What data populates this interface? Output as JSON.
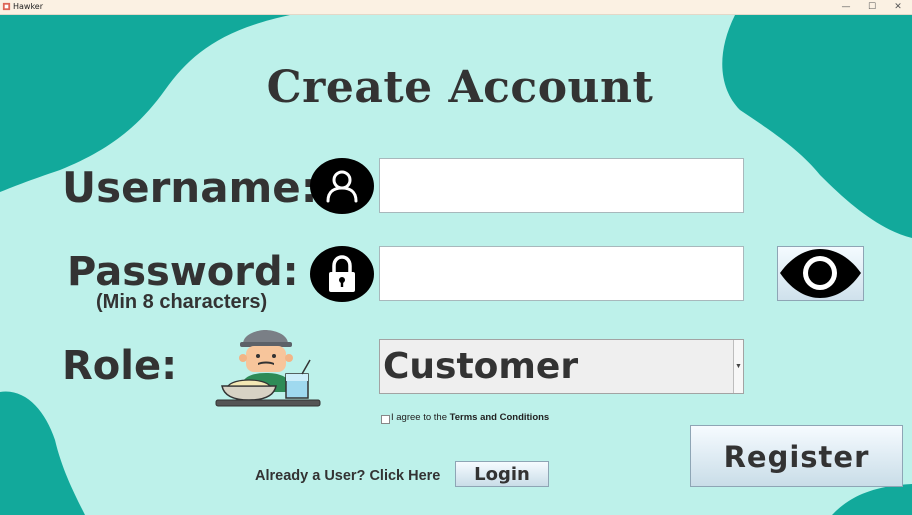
{
  "window": {
    "title": "Hawker",
    "minimize_glyph": "—",
    "maximize_glyph": "☐",
    "close_glyph": "✕"
  },
  "form": {
    "heading": "Create Account",
    "username": {
      "label": "Username:",
      "value": "",
      "icon": "user-icon"
    },
    "password": {
      "label": "Password:",
      "hint": "(Min 8 characters)",
      "value": "",
      "icon": "lock-icon",
      "toggle_icon": "eye-icon"
    },
    "role": {
      "label": "Role:",
      "selected": "Customer",
      "illustration": "hawker-vendor-illustration"
    },
    "terms": {
      "prefix": "I agree to the ",
      "link": "Terms and Conditions",
      "checked": false
    },
    "already_user": "Already a User? Click Here",
    "login_label": "Login",
    "register_label": "Register"
  },
  "colors": {
    "background": "#bdf1ea",
    "blob": "#12a99b",
    "text": "#333333"
  }
}
